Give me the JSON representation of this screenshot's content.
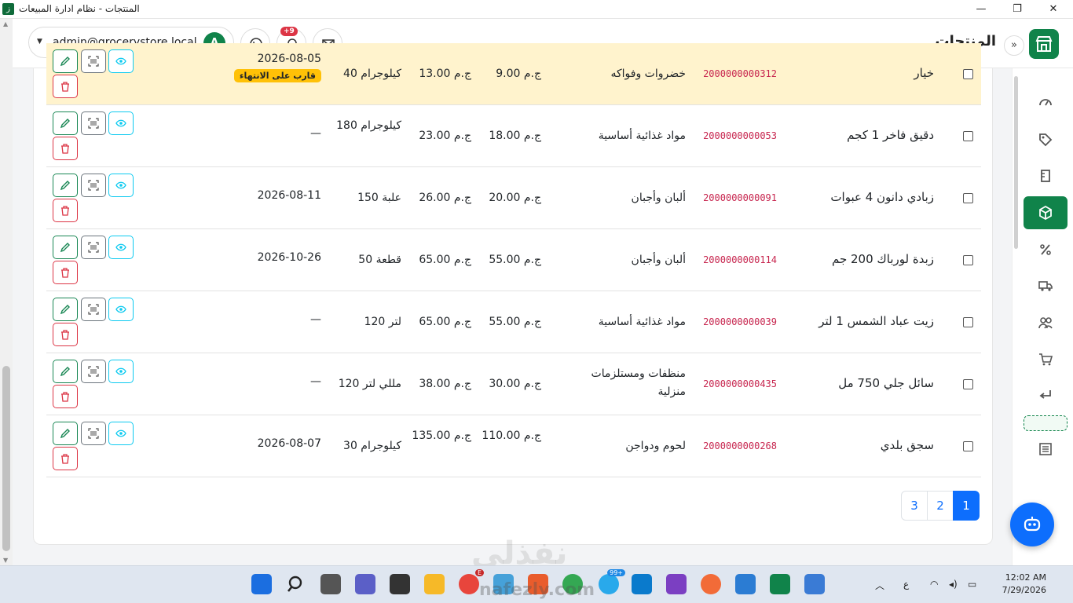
{
  "window": {
    "title": "المنتجات - نظام ادارة المبيعات",
    "app_glyph": "ز"
  },
  "header": {
    "page_title": "المنتجات",
    "user_email": "admin@grocerystore.local",
    "avatar_letter": "A",
    "notifications_count": "+9"
  },
  "rows": [
    {
      "name": "خيار",
      "barcode": "2000000000312",
      "category": "خضروات وفواكه",
      "price": "9.00 ج.م",
      "cost": "13.00 ج.م",
      "stock": "40 كيلوجرام",
      "expiry": "2026-08-05",
      "badge": "قارب على الانتهاء"
    },
    {
      "name": "دقيق فاخر 1 كجم",
      "barcode": "2000000000053",
      "category": "مواد غذائية أساسية",
      "price": "18.00 ج.م",
      "cost": "23.00 ج.م",
      "stock": "180 كيلوجرام",
      "expiry": "—"
    },
    {
      "name": "زبادي دانون 4 عبوات",
      "barcode": "2000000000091",
      "category": "ألبان وأجبان",
      "price": "20.00 ج.م",
      "cost": "26.00 ج.م",
      "stock": "150 علبة",
      "expiry": "2026-08-11"
    },
    {
      "name": "زبدة لورباك 200 جم",
      "barcode": "2000000000114",
      "category": "ألبان وأجبان",
      "price": "55.00 ج.م",
      "cost": "65.00 ج.م",
      "stock": "50 قطعة",
      "expiry": "2026-10-26"
    },
    {
      "name": "زيت عباد الشمس 1 لتر",
      "barcode": "2000000000039",
      "category": "مواد غذائية أساسية",
      "price": "55.00 ج.م",
      "cost": "65.00 ج.م",
      "stock": "120 لتر",
      "expiry": "—"
    },
    {
      "name": "سائل جلي 750 مل",
      "barcode": "2000000000435",
      "category": "منظفات ومستلزمات منزلية",
      "price": "30.00 ج.م",
      "cost": "38.00 ج.م",
      "stock": "120 مللي لتر",
      "expiry": "—"
    },
    {
      "name": "سجق بلدي",
      "barcode": "2000000000268",
      "category": "لحوم ودواجن",
      "price": "110.00 ج.م",
      "cost": "135.00 ج.م",
      "stock": "30 كيلوجرام",
      "expiry": "2026-08-07"
    }
  ],
  "pagination": {
    "pages": [
      "3",
      "2",
      "1"
    ],
    "active": "1"
  },
  "taskbar": {
    "time": "12:02 AM",
    "date": "7/29/2026",
    "lang": "ع",
    "badge_99": "99+",
    "badge_e": "E",
    "watermark": "nafezly.com"
  },
  "watermark_text": "نفذلي",
  "icons": {
    "sidebar": [
      "dashboard-icon",
      "tag-icon",
      "ruler-icon",
      "box-icon",
      "percent-icon",
      "truck-icon",
      "users-icon",
      "cart-icon",
      "return-icon",
      "placeholder",
      "invoice-icon"
    ]
  },
  "colors": {
    "primary": "#10834a",
    "warning_row": "#fff3cd",
    "badge": "#ffc107",
    "link": "#0d6efd"
  }
}
